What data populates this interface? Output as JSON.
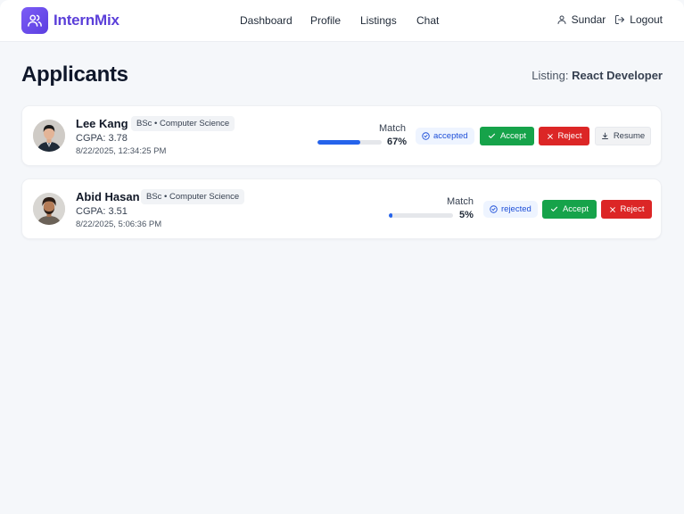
{
  "app": {
    "name": "InternMix"
  },
  "nav": {
    "items": [
      "Dashboard",
      "Profile",
      "Listings",
      "Chat"
    ]
  },
  "user": {
    "name": "Sundar",
    "logout_label": "Logout"
  },
  "page": {
    "title": "Applicants",
    "listing_prefix": "Listing:",
    "listing_name": "React Developer"
  },
  "applicants": [
    {
      "name": "Lee Kang",
      "degree": "BSc • Computer Science",
      "cgpa": "CGPA: 3.78",
      "date": "8/22/2025, 12:34:25 PM",
      "match_label": "Match",
      "match_pct": "67%",
      "match_value": 67,
      "status": "accepted",
      "accept_label": "Accept",
      "reject_label": "Reject",
      "resume_label": "Resume"
    },
    {
      "name": "Abid Hasan",
      "degree": "BSc • Computer Science",
      "cgpa": "CGPA: 3.51",
      "date": "8/22/2025, 5:06:36 PM",
      "match_label": "Match",
      "match_pct": "5%",
      "match_value": 5,
      "status": "rejected",
      "accept_label": "Accept",
      "reject_label": "Reject"
    }
  ],
  "colors": {
    "brand": "#5b3fd9",
    "accept": "#16a34a",
    "reject": "#dc2626",
    "progress": "#2563eb",
    "status_bg": "#eef4ff"
  },
  "icons": {
    "logo": "users-icon",
    "user": "user-icon",
    "logout": "logout-icon",
    "status": "check-circle-icon",
    "accept": "check-icon",
    "reject": "x-icon",
    "resume": "download-icon"
  }
}
